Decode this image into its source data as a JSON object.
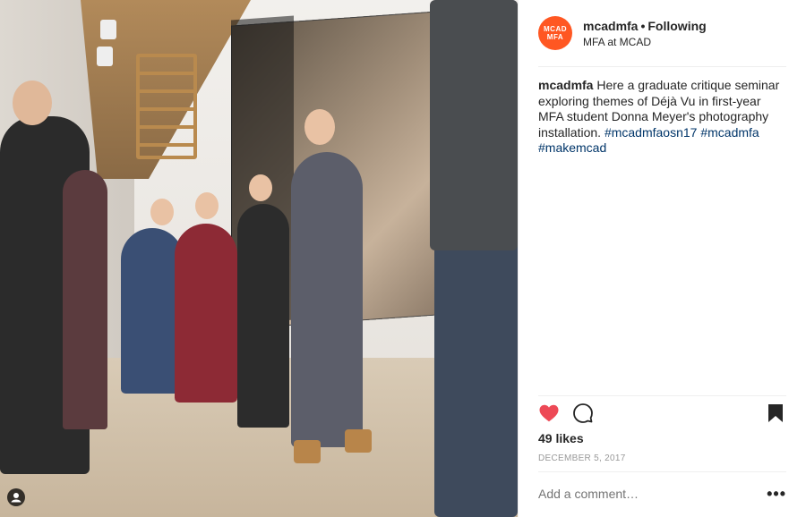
{
  "header": {
    "logo_line1": "MCAD",
    "logo_line2": "MFA",
    "username": "mcadmfa",
    "separator": "•",
    "follow_state": "Following",
    "location": "MFA at MCAD"
  },
  "caption": {
    "username": "mcadmfa",
    "text": " Here a graduate critique seminar exploring themes of Déjà Vu in first-year MFA student Donna Meyer's photography installation. ",
    "hashtags": [
      "#mcadmfaosn17",
      "#mcadmfa",
      "#makemcad"
    ]
  },
  "actions": {
    "like_icon": "heart-filled-icon",
    "comment_icon": "comment-bubble-icon",
    "save_icon": "bookmark-icon",
    "like_color": "#ed4956"
  },
  "likes": "49 likes",
  "date": "DECEMBER 5, 2017",
  "comment": {
    "placeholder": "Add a comment…",
    "more": "•••"
  },
  "colors": {
    "brand": "#ff5722",
    "hashtag": "#003569",
    "muted": "#999999"
  }
}
